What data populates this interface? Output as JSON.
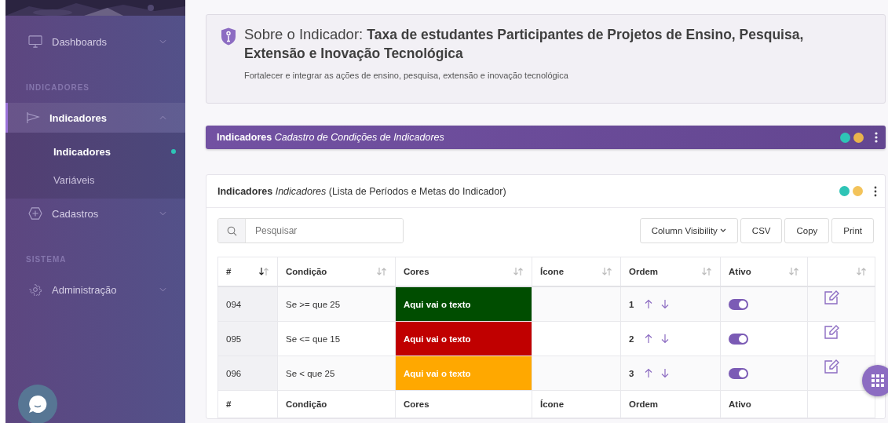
{
  "sidebar": {
    "items": [
      {
        "kind": "item",
        "label": "Dashboards",
        "expanded": false,
        "selected": false
      },
      {
        "kind": "section",
        "label": "INDICADORES"
      },
      {
        "kind": "item",
        "label": "Indicadores",
        "expanded": true,
        "selected": true,
        "children": [
          {
            "label": "Indicadores",
            "selected": true
          },
          {
            "label": "Variáveis",
            "selected": false
          }
        ]
      },
      {
        "kind": "item",
        "label": "Cadastros",
        "expanded": false,
        "selected": false
      },
      {
        "kind": "section",
        "label": "SISTEMA"
      },
      {
        "kind": "item",
        "label": "Administração",
        "expanded": false,
        "selected": false
      }
    ]
  },
  "info": {
    "title": "Sobre o Indicador: **Taxa de estudantes Participantes de Projetos de Ensino, Pesquisa, Extensão e Inovação Tecnológica**",
    "description": "Fortalecer e integrar as ações de ensino, pesquisa, extensão e inovação tecnológica"
  },
  "header_bar": {
    "title": "**Indicadores** *Cadastro de Condições de Indicadores*",
    "dots": [
      {
        "color": "#2ec4b6"
      },
      {
        "color": "#e9b44c"
      }
    ]
  },
  "card": {
    "title": "**Indicadores** *Indicadores* (Lista de Períodos e Metas do Indicador)",
    "dots": [
      {
        "color": "#2ec4b6"
      },
      {
        "color": "#f3c35a"
      }
    ],
    "search": {
      "placeholder": "Pesquisar"
    },
    "buttons": [
      {
        "label": "Column Visibility",
        "kind": "dropdown"
      },
      {
        "label": "CSV",
        "kind": "plain"
      },
      {
        "label": "Copy",
        "kind": "plain"
      },
      {
        "label": "Print",
        "kind": "plain"
      }
    ],
    "table": {
      "columns": [
        {
          "label": "#",
          "sorted": true
        },
        {
          "label": "Condição",
          "sorted": false
        },
        {
          "label": "Cores",
          "sorted": false
        },
        {
          "label": "Ícone",
          "sorted": false
        },
        {
          "label": "Ordem",
          "sorted": false
        },
        {
          "label": "Ativo",
          "sorted": false
        },
        {
          "sorted": false
        }
      ],
      "rows": [
        {
          "id": "094",
          "condition": "Se >= que 25",
          "color_text": "Aqui vai o texto",
          "color": "#004d00",
          "order": "1",
          "active": true
        },
        {
          "id": "095",
          "condition": "Se <= que 15",
          "color_text": "Aqui vai o texto",
          "color": "#c00000",
          "order": "2",
          "active": true
        },
        {
          "id": "096",
          "condition": "Se < que 25",
          "color_text": "Aqui vai o texto",
          "color": "#ffa800",
          "order": "3",
          "active": true
        }
      ],
      "footer": [
        "#",
        "Condição",
        "Cores",
        "Ícone",
        "Ordem",
        "Ativo"
      ]
    }
  }
}
